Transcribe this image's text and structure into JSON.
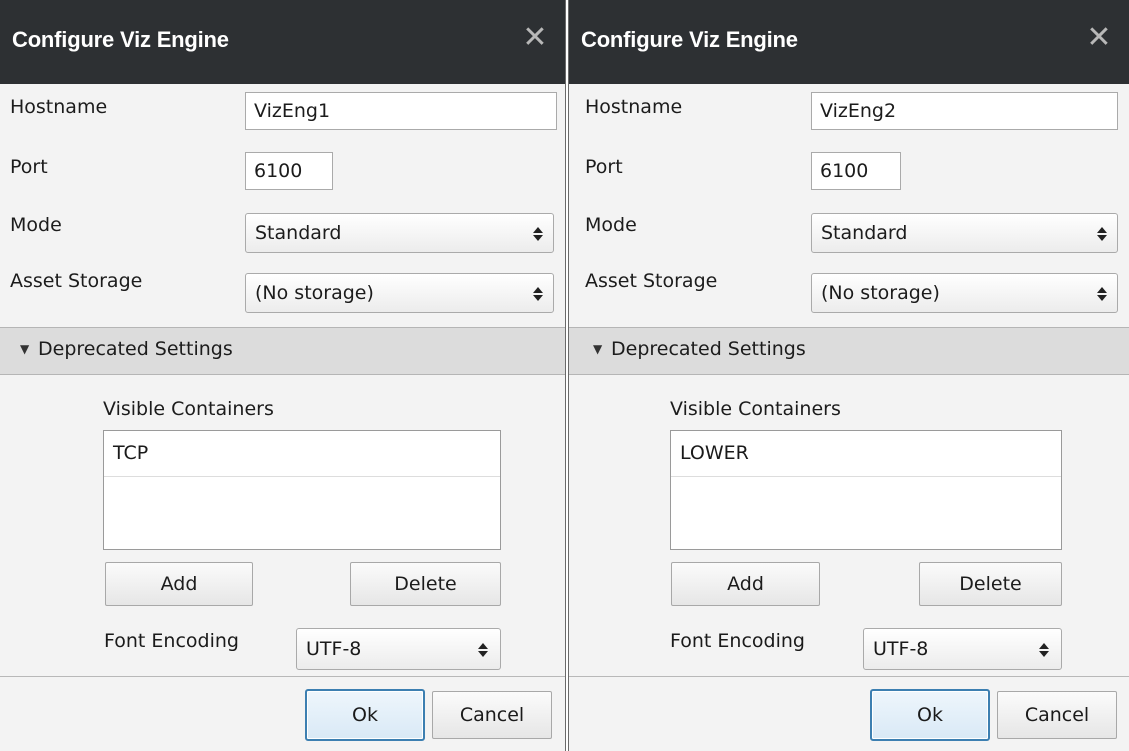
{
  "dialogs": [
    {
      "title": "Configure Viz Engine",
      "close_glyph": "✕",
      "hostname_label": "Hostname",
      "hostname_value": "VizEng1",
      "port_label": "Port",
      "port_value": "6100",
      "mode_label": "Mode",
      "mode_value": "Standard",
      "asset_storage_label": "Asset Storage",
      "asset_storage_value": "(No storage)",
      "section_label": "Deprecated Settings",
      "section_icon": "triangle-down-icon",
      "containers_label": "Visible Containers",
      "containers": [
        "TCP"
      ],
      "add_label": "Add",
      "delete_label": "Delete",
      "font_encoding_label": "Font Encoding",
      "font_encoding_value": "UTF-8",
      "ok_label": "Ok",
      "cancel_label": "Cancel"
    },
    {
      "title": "Configure Viz Engine",
      "close_glyph": "✕",
      "hostname_label": "Hostname",
      "hostname_value": "VizEng2",
      "port_label": "Port",
      "port_value": "6100",
      "mode_label": "Mode",
      "mode_value": "Standard",
      "asset_storage_label": "Asset Storage",
      "asset_storage_value": "(No storage)",
      "section_label": "Deprecated Settings",
      "section_icon": "triangle-down-icon",
      "containers_label": "Visible Containers",
      "containers": [
        "LOWER"
      ],
      "add_label": "Add",
      "delete_label": "Delete",
      "font_encoding_label": "Font Encoding",
      "font_encoding_value": "UTF-8",
      "ok_label": "Ok",
      "cancel_label": "Cancel"
    }
  ],
  "colors": {
    "titlebar": "#2d3033",
    "dialog_bg": "#f3f3f3",
    "section_bg": "#dcdcdc",
    "ok_border": "#3c7fb1"
  }
}
